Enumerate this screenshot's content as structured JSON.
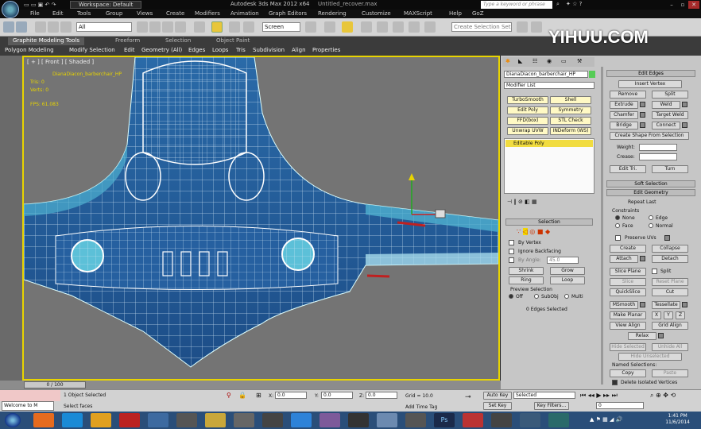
{
  "titlebar": {
    "workspace": "Workspace: Default",
    "app_title": "Autodesk 3ds Max 2012 x64",
    "file_title": "Untitled_recover.max",
    "search_placeholder": "Type a keyword or phrase"
  },
  "menu": [
    "File",
    "Edit",
    "Tools",
    "Group",
    "Views",
    "Create",
    "Modifiers",
    "Animation",
    "Graph Editors",
    "Rendering",
    "Customize",
    "MAXScript",
    "Help",
    "GoZ"
  ],
  "toolbar": {
    "selection_filter": "All",
    "ref_coord": "Screen",
    "named_selection_placeholder": "Create Selection Set"
  },
  "ribbon": {
    "tabs": [
      "Graphite Modeling Tools",
      "Freeform",
      "Selection",
      "Object Paint"
    ],
    "subtabs": [
      "Polygon Modeling",
      "Modify Selection",
      "Edit",
      "Geometry (All)",
      "Edges",
      "Loops",
      "Tris",
      "Subdivision",
      "Align",
      "Properties"
    ]
  },
  "watermark": "YIHUU.COM",
  "viewport": {
    "label": "[ + ] [ Front ] [ Shaded ]",
    "object_name": "DianaDiacon_barberchair_HP",
    "stats": [
      "Tris: 0",
      "Verts: 0",
      "FPS: 61.083"
    ]
  },
  "command_panel": {
    "object_name": "DianaDiacon_barberchair_HP",
    "modifier_list": "Modifier List",
    "modifier_buttons": [
      "TurboSmooth",
      "Shell",
      "Edit Poly",
      "Symmetry",
      "FFD(box)",
      "STL Check",
      "Unwrap UVW",
      "INDeform (WS)"
    ],
    "stack_item": "Editable Poly",
    "selection": {
      "title": "Selection",
      "by_vertex": "By Vertex",
      "ignore_backfacing": "Ignore Backfacing",
      "by_angle": "By Angle:",
      "by_angle_value": "45.0",
      "shrink": "Shrink",
      "grow": "Grow",
      "ring": "Ring",
      "loop": "Loop",
      "preview_selection": "Preview Selection",
      "preview_off": "Off",
      "preview_subobj": "SubObj",
      "preview_multi": "Multi",
      "status": "0 Edges Selected"
    },
    "edit_edges": {
      "title": "Edit Edges",
      "insert_vertex": "Insert Vertex",
      "remove": "Remove",
      "split": "Split",
      "extrude": "Extrude",
      "weld": "Weld",
      "chamfer": "Chamfer",
      "target_weld": "Target Weld",
      "bridge": "Bridge",
      "connect": "Connect",
      "create_shape": "Create Shape From Selection",
      "weight": "Weight:",
      "crease": "Crease:",
      "edit_tri": "Edit Tri.",
      "turn": "Turn"
    },
    "soft_selection": "Soft Selection",
    "edit_geometry": {
      "title": "Edit Geometry",
      "repeat_last": "Repeat Last",
      "constraints": "Constraints",
      "c_none": "None",
      "c_edge": "Edge",
      "c_face": "Face",
      "c_normal": "Normal",
      "preserve_uvs": "Preserve UVs",
      "create": "Create",
      "collapse": "Collapse",
      "attach": "Attach",
      "detach": "Detach",
      "slice_plane": "Slice Plane",
      "split": "Split",
      "slice": "Slice",
      "reset_plane": "Reset Plane",
      "quickslice": "QuickSlice",
      "cut": "Cut",
      "msmooth": "MSmooth",
      "tessellate": "Tessellate",
      "make_planar": "Make Planar",
      "x": "X",
      "y": "Y",
      "z": "Z",
      "view_align": "View Align",
      "grid_align": "Grid Align",
      "relax": "Relax",
      "hide_selected": "Hide Selected",
      "unhide_all": "Unhide All",
      "hide_unselected": "Hide Unselected",
      "named_selections": "Named Selections:",
      "copy": "Copy",
      "paste": "Paste",
      "delete_isolated": "Delete Isolated Vertices"
    }
  },
  "timeline": {
    "frame": "0 / 100"
  },
  "status": {
    "selected": "1 Object Selected",
    "prompt": "Select faces",
    "x_label": "X:",
    "x_val": "0.0",
    "y_label": "Y:",
    "y_val": "0.0",
    "z_label": "Z:",
    "z_val": "0.0",
    "grid": "Grid = 10.0",
    "add_time_tag": "Add Time Tag",
    "auto_key": "Auto Key",
    "set_key": "Set Key",
    "selected_dd": "Selected",
    "key_filters": "Key Filters...",
    "frame_field": "0",
    "welcome": "Welcome to M"
  },
  "taskbar": {
    "time": "1:41 PM",
    "date": "11/6/2014"
  }
}
